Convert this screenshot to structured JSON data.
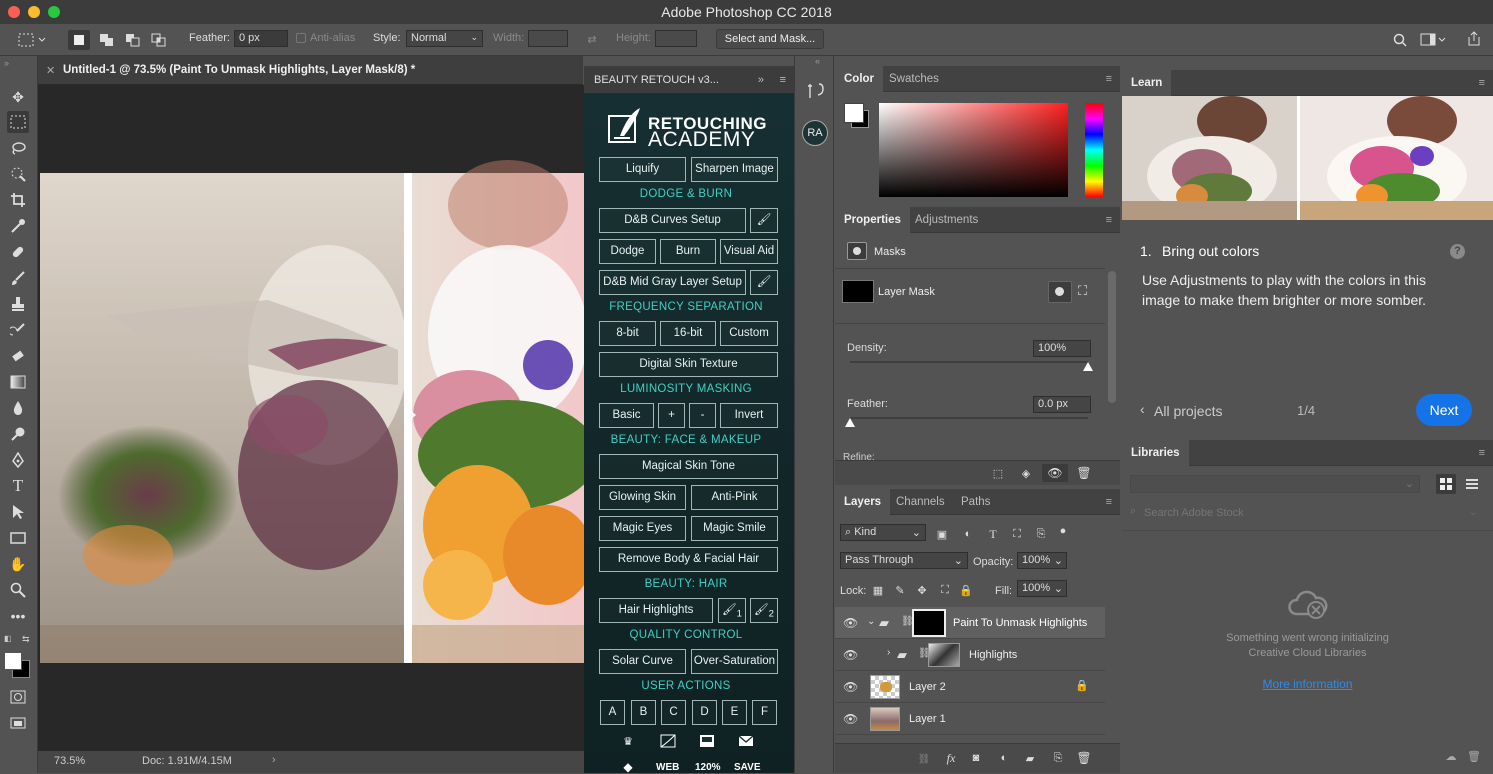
{
  "window": {
    "title": "Adobe Photoshop CC 2018"
  },
  "options": {
    "feather_label": "Feather:",
    "feather_value": "0 px",
    "antialias_label": "Anti-alias",
    "style_label": "Style:",
    "style_value": "Normal",
    "width_label": "Width:",
    "height_label": "Height:",
    "select_mask": "Select and Mask..."
  },
  "document": {
    "tab_title": "Untitled-1 @ 73.5% (Paint To Unmask Highlights, Layer Mask/8) *",
    "zoom": "73.5%",
    "doc_size": "Doc: 1.91M/4.15M"
  },
  "raw_panel": {
    "title": "BEAUTY RETOUCH v3...",
    "logo_line1": "RETOUCHING",
    "logo_line2": "ACADEMY",
    "buttons": {
      "liquify": "Liquify",
      "sharpen": "Sharpen Image",
      "db_curves": "D&B Curves Setup",
      "dodge": "Dodge",
      "burn": "Burn",
      "visual_aid": "Visual Aid",
      "db_mid": "D&B Mid Gray Layer Setup",
      "bit8": "8-bit",
      "bit16": "16-bit",
      "custom": "Custom",
      "digital_skin": "Digital Skin Texture",
      "basic": "Basic",
      "plus": "+",
      "minus": "-",
      "invert": "Invert",
      "magical_skin": "Magical Skin Tone",
      "glowing": "Glowing Skin",
      "antipink": "Anti-Pink",
      "magic_eyes": "Magic Eyes",
      "magic_smile": "Magic Smile",
      "remove_hair": "Remove Body & Facial Hair",
      "hair_highlights": "Hair Highlights",
      "brush1": "1",
      "brush2": "2",
      "solar": "Solar Curve",
      "oversat": "Over-Saturation",
      "a": "A",
      "b": "B",
      "c": "C",
      "d": "D",
      "e": "E",
      "f": "F"
    },
    "sections": {
      "db": "DODGE & BURN",
      "freq": "FREQUENCY SEPARATION",
      "lum": "LUMINOSITY MASKING",
      "face": "BEAUTY: FACE & MAKEUP",
      "hair": "BEAUTY: HAIR",
      "qc": "QUALITY CONTROL",
      "user": "USER ACTIONS"
    },
    "bottom": {
      "web": "WEB",
      "pct": "120%",
      "save": "SAVE"
    }
  },
  "strip": {
    "ra": "RA"
  },
  "color_panel": {
    "tab_color": "Color",
    "tab_swatches": "Swatches"
  },
  "properties": {
    "tab_props": "Properties",
    "tab_adj": "Adjustments",
    "masks": "Masks",
    "layer_mask": "Layer Mask",
    "density_label": "Density:",
    "density_value": "100%",
    "density_pct": 100,
    "feather_label": "Feather:",
    "feather_value": "0.0 px",
    "feather_pct": 0,
    "refine": "Refine:"
  },
  "layers": {
    "tab_layers": "Layers",
    "tab_channels": "Channels",
    "tab_paths": "Paths",
    "kind": "Kind",
    "blend": "Pass Through",
    "opacity_label": "Opacity:",
    "opacity": "100%",
    "lock_label": "Lock:",
    "fill_label": "Fill:",
    "fill": "100%",
    "items": [
      {
        "name": "Paint To Unmask Highlights"
      },
      {
        "name": "Highlights"
      },
      {
        "name": "Layer 2"
      },
      {
        "name": "Layer 1"
      }
    ]
  },
  "learn": {
    "tab": "Learn",
    "step": "1.",
    "heading": "Bring out colors",
    "body": "Use Adjustments to play with the colors in this image to make them brighter or more somber.",
    "all_projects": "All projects",
    "page": "1/4",
    "next": "Next"
  },
  "libraries": {
    "tab": "Libraries",
    "search_placeholder": "Search Adobe Stock",
    "error1": "Something went wrong initializing",
    "error2": "Creative Cloud Libraries",
    "more": "More information"
  },
  "colors": {
    "accent": "#1473e6",
    "teal": "#3fd0c4",
    "panel_bg": "#535353",
    "dark": "#282828"
  }
}
